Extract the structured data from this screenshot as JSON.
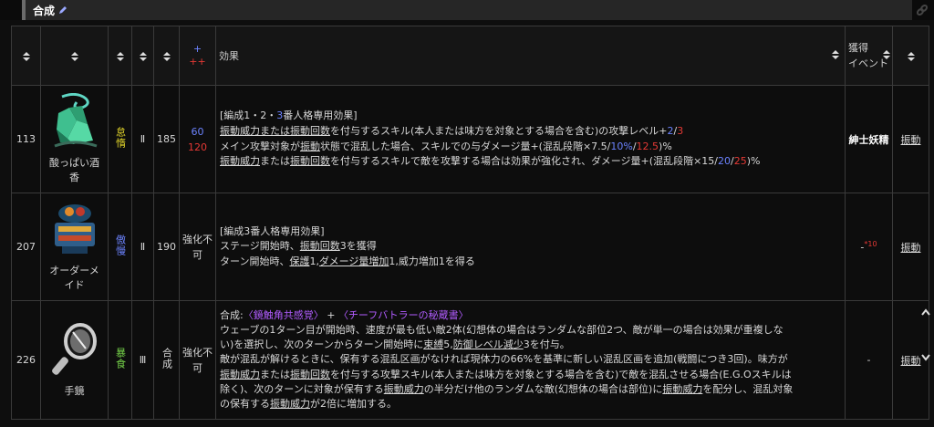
{
  "section": {
    "title": "合成"
  },
  "headers": {
    "plus": "+",
    "plusplus": "++",
    "effect": "効果",
    "event": "獲得\nイベント"
  },
  "rows": [
    {
      "id": "113",
      "sin": "怠惰",
      "tier": "Ⅱ",
      "price": "185",
      "cost_plus": "60",
      "cost_plusplus": "120",
      "name": "酸っぱい酒香",
      "event": "紳士妖精",
      "keyword": "振動",
      "effect": [
        "[編成1・2・3番人格専用効果]",
        "振動威力または振動回数を付与するスキル(本人または味方を対象とする場合を含む)の攻撃レベル+2/3",
        "メイン攻撃対象が振動状態で混乱した場合、スキルでの与ダメージ量+(混乱段階×7.5/10%/12.5)%",
        "振動威力または振動回数を付与するスキルで敵を攻撃する場合は効果が強化され、ダメージ量+(混乱段階×15/20/25)%"
      ]
    },
    {
      "id": "207",
      "sin": "傲慢",
      "tier": "Ⅱ",
      "price": "190",
      "cost": "強化不可",
      "name": "オーダーメイド",
      "event": "-",
      "event_note": "*10",
      "keyword": "振動",
      "effect": [
        "[編成3番人格専用効果]",
        "ステージ開始時、振動回数3を獲得",
        "ターン開始時、保護1,ダメージ量増加1,威力増加1を得る"
      ]
    },
    {
      "id": "226",
      "sin": "暴食",
      "tier": "Ⅲ",
      "price": "合成",
      "cost": "強化不可",
      "name": "手鏡",
      "event": "-",
      "keyword": "振動",
      "effect_head": "合成:",
      "recipe1": "〈鏡触角共感覚〉",
      "recipe_plus": "+",
      "recipe2": "〈チーフバトラーの秘蔵書〉",
      "effect": [
        "ウェーブの1ターン目が開始時、速度が最も低い敵2体(幻想体の場合はランダムな部位2つ、敵が単一の場合は効果が重複しな",
        "い)を選択し、次のターンからターン開始時に束縛5,防御レベル減少3を付与。",
        "敵が混乱が解けるときに、保有する混乱区画がなければ現体力の66%を基準に新しい混乱区画を追加(戦闘につき3回)。味方が",
        "振動威力または振動回数を付与する攻撃スキル(本人または味方を対象とする場合を含む)で敵を混乱させる場合(E.G.Oスキルは",
        "除く)、次のターンに対象が保有する振動威力の半分だけ他のランダムな敵(幻想体の場合は部位)に振動威力を配分し、混乱対象",
        "の保有する振動威力が2倍に増加する。"
      ]
    }
  ],
  "colors": {
    "sloth": "#e6d92b",
    "pride": "#6c83ff",
    "gluttony": "#78d64b",
    "plus": "#6c83ff",
    "plusplus": "#e53935"
  }
}
